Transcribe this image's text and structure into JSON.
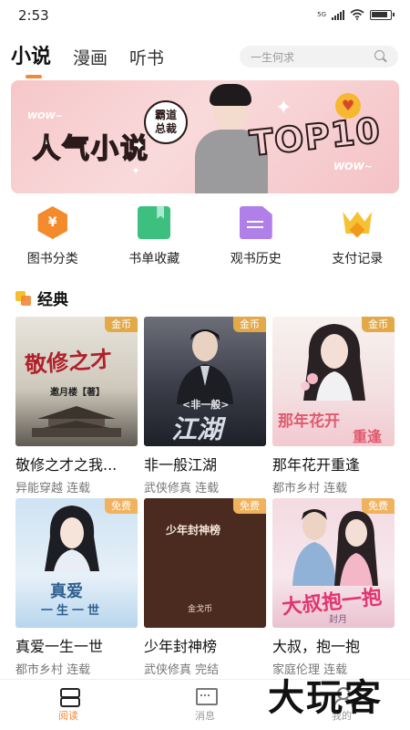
{
  "status_bar": {
    "time": "2:53",
    "network": "5G"
  },
  "top_tabs": [
    {
      "label": "小说",
      "active": true
    },
    {
      "label": "漫画",
      "active": false
    },
    {
      "label": "听书",
      "active": false
    }
  ],
  "search": {
    "placeholder": "一生何求"
  },
  "banner": {
    "badge_line1": "霸道",
    "badge_line2": "总裁",
    "title": "人气小说",
    "ribbon": "TOP10",
    "wow_left": "WOW~",
    "wow_right": "WOW~"
  },
  "quick_menu": [
    {
      "label": "图书分类",
      "icon": "category-icon",
      "icon_char": "¥"
    },
    {
      "label": "书单收藏",
      "icon": "bookmark-icon"
    },
    {
      "label": "观书历史",
      "icon": "history-icon"
    },
    {
      "label": "支付记录",
      "icon": "crown-icon"
    }
  ],
  "section": {
    "title": "经典"
  },
  "books": [
    {
      "title": "敬修之才之我...",
      "category": "异能穿越",
      "status": "连载",
      "tag": "金币",
      "cover_text": "敬修之才",
      "cover_sub": "邀月楼【著】"
    },
    {
      "title": "非一般江湖",
      "category": "武侠修真",
      "status": "连载",
      "tag": "金币",
      "cover_text": "江湖",
      "cover_sub": "<非一般>"
    },
    {
      "title": "那年花开重逢",
      "category": "都市乡村",
      "status": "连载",
      "tag": "金币",
      "cover_text": "那年花开",
      "cover_sub": "重逢"
    },
    {
      "title": "真爱一生一世",
      "category": "都市乡村",
      "status": "连载",
      "tag": "免费",
      "cover_text": "真爱",
      "cover_sub": "一生一世"
    },
    {
      "title": "少年封神榜",
      "category": "武侠修真",
      "status": "完结",
      "tag": "免费",
      "cover_text": "少年封神榜",
      "cover_sub": "金戈币"
    },
    {
      "title": "大叔，抱一抱",
      "category": "家庭伦理",
      "status": "连载",
      "tag": "免费",
      "cover_text": "大叔抱一抱",
      "cover_sub": "封月"
    }
  ],
  "bottom_nav": [
    {
      "label": "阅读",
      "active": true
    },
    {
      "label": "消息",
      "active": false
    },
    {
      "label": "我的",
      "active": false
    }
  ],
  "watermark": "大玩客",
  "colors": {
    "accent": "#f08a3a",
    "tag_gold": "#e3a948",
    "tag_free": "#f1b25e"
  }
}
